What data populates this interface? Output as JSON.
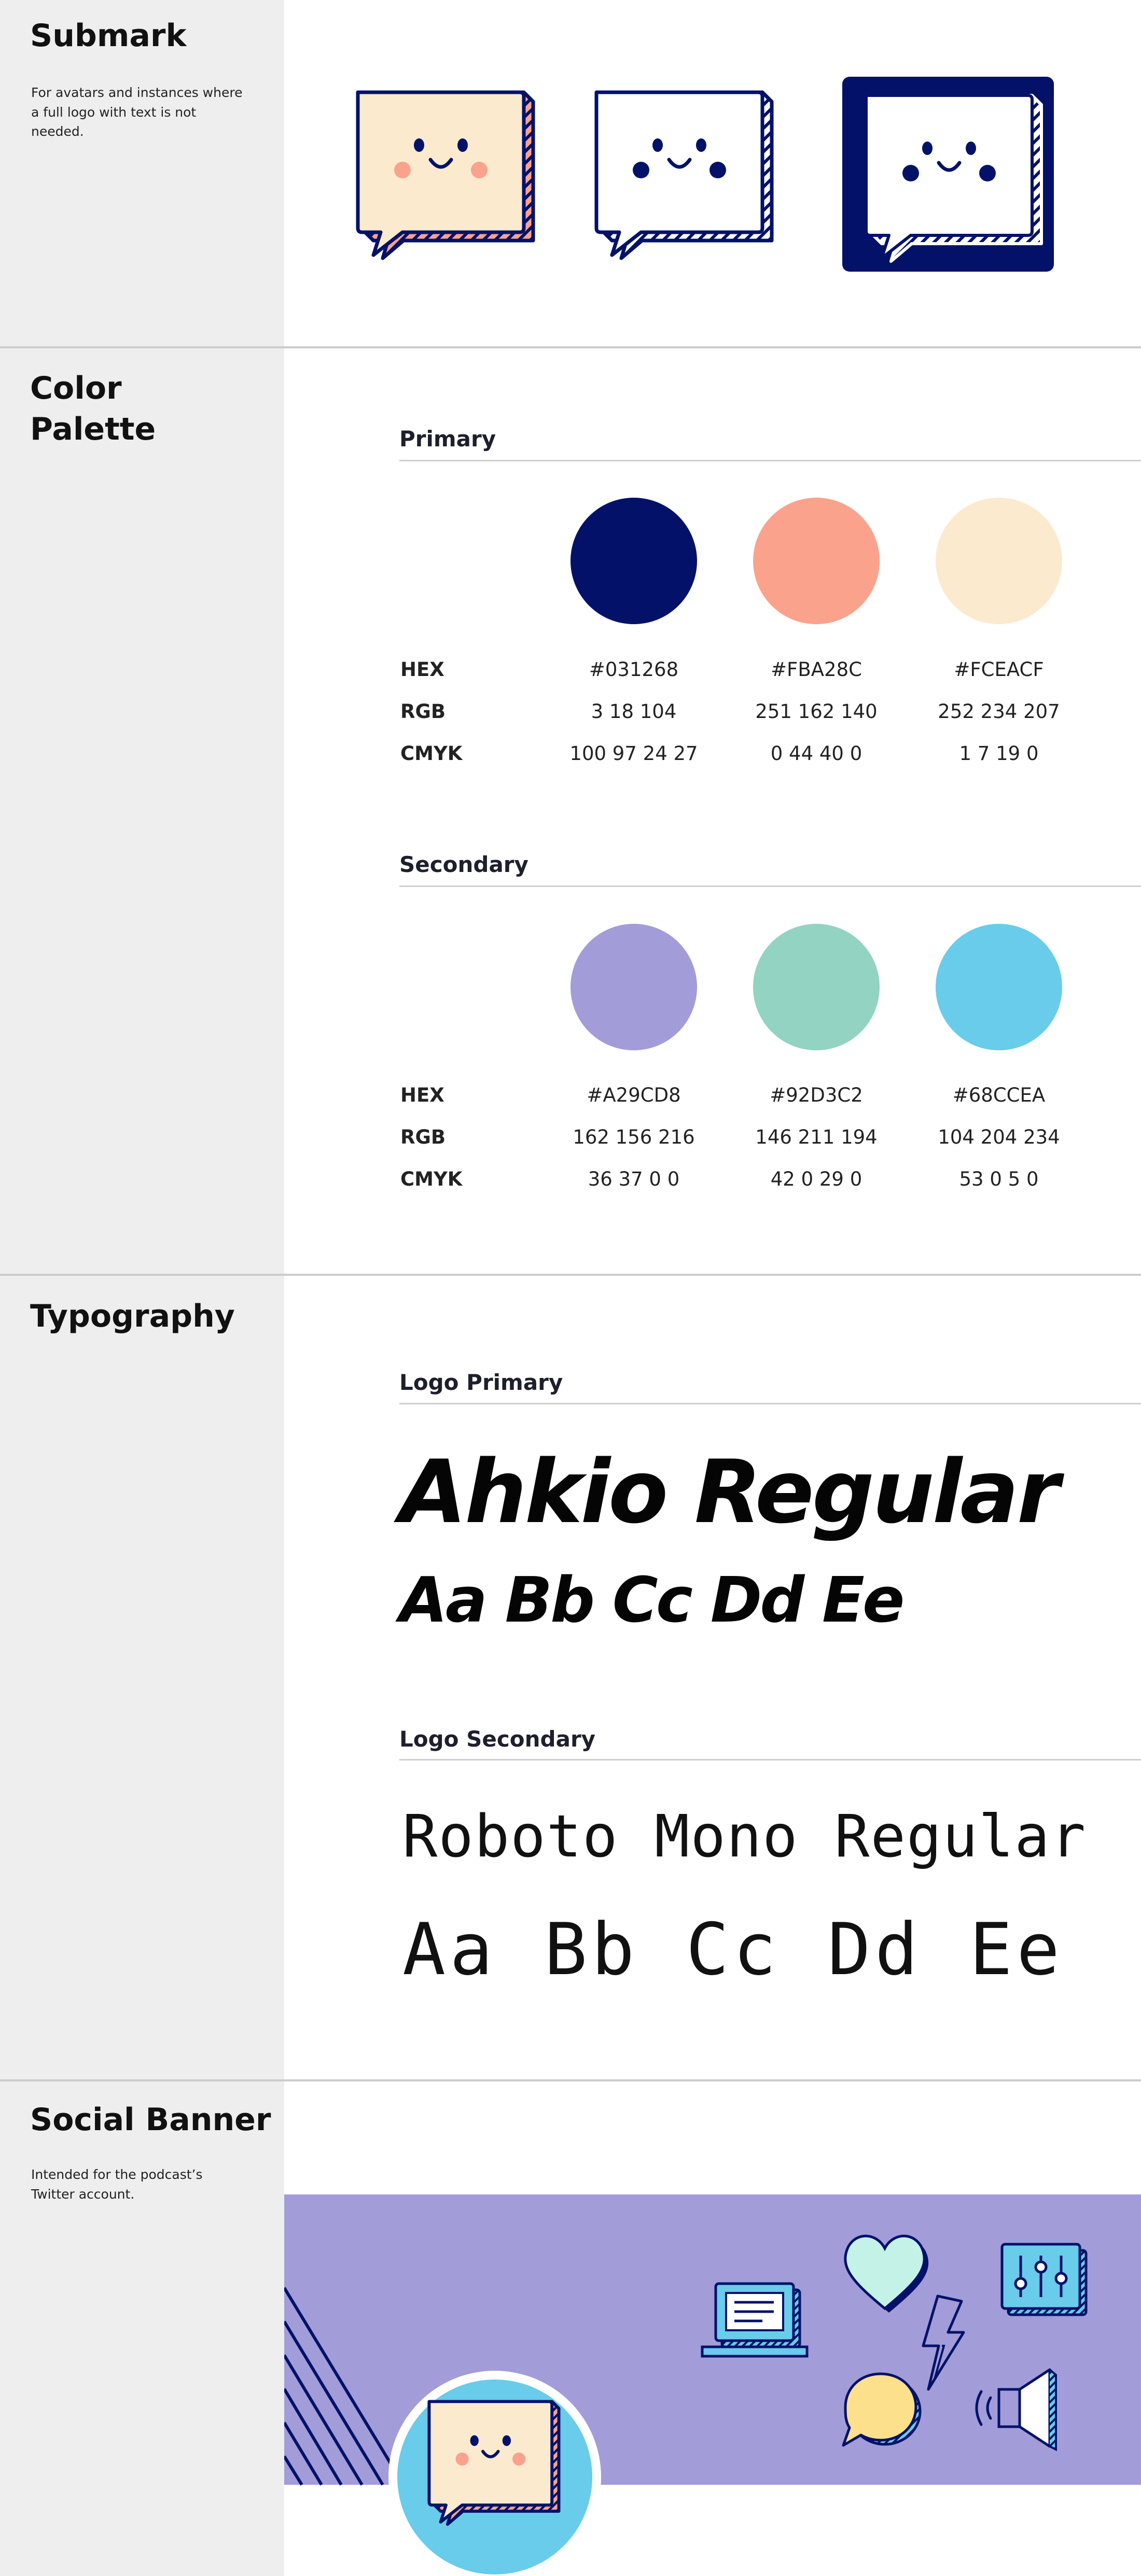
{
  "colors": {
    "navy": "#031268",
    "coral": "#FBA28C",
    "cream": "#FCEACF",
    "lavender": "#A29CD8",
    "mint": "#92D3C2",
    "sky": "#68CCEA",
    "yellow": "#FDE08B"
  },
  "submark": {
    "title": "Submark",
    "description": "For avatars and instances where a full logo with text is not needed."
  },
  "palette": {
    "title_line1": "Color",
    "title_line2": "Palette",
    "row_labels": {
      "hex": "HEX",
      "rgb": "RGB",
      "cmyk": "CMYK"
    },
    "primary": {
      "heading": "Primary",
      "swatches": [
        {
          "hex": "#031268",
          "rgb": "3 18 104",
          "cmyk": "100 97 24 27"
        },
        {
          "hex": "#FBA28C",
          "rgb": "251 162 140",
          "cmyk": "0 44 40 0"
        },
        {
          "hex": "#FCEACF",
          "rgb": "252 234 207",
          "cmyk": "1 7 19 0"
        }
      ]
    },
    "secondary": {
      "heading": "Secondary",
      "swatches": [
        {
          "hex": "#A29CD8",
          "rgb": "162 156 216",
          "cmyk": "36 37 0 0"
        },
        {
          "hex": "#92D3C2",
          "rgb": "146 211 194",
          "cmyk": "42 0 29 0"
        },
        {
          "hex": "#68CCEA",
          "rgb": "104 204 234",
          "cmyk": "53 0 5 0"
        }
      ]
    }
  },
  "typography": {
    "title": "Typography",
    "primary_heading": "Logo Primary",
    "primary_font_name": "Ahkio Regular",
    "primary_sample": "Aa Bb Cc Dd Ee",
    "secondary_heading": "Logo Secondary",
    "secondary_font_name": "Roboto Mono Regular",
    "secondary_sample": "Aa Bb Cc Dd Ee"
  },
  "banner": {
    "title": "Social Banner",
    "description": "Intended for the podcast’s Twitter account.",
    "icons": [
      "laptop-icon",
      "heart-icon",
      "lightning-icon",
      "speech-bubble-icon",
      "megaphone-icon",
      "equalizer-icon"
    ]
  }
}
